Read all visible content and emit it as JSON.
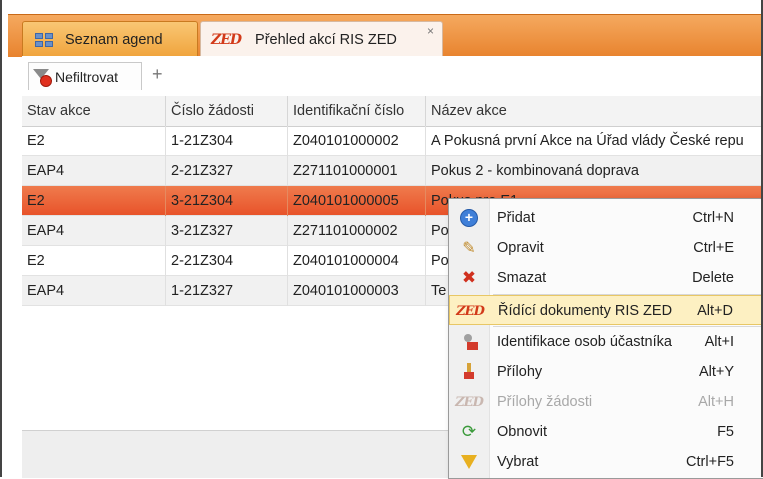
{
  "tabs": [
    {
      "label": "Seznam agend",
      "icon": "grid-icon"
    },
    {
      "label": "Přehled akcí RIS ZED",
      "icon": "zed-logo-icon",
      "close": "×"
    }
  ],
  "zed_logo_text": "ZED",
  "toolbar": {
    "filter_label": "Nefiltrovat",
    "add_tab": "+"
  },
  "grid": {
    "columns": [
      "Stav akce",
      "Číslo žádosti",
      "Identifikační číslo",
      "Název akce"
    ],
    "rows": [
      {
        "c": [
          "E2",
          "1-21Z304",
          "Z040101000002",
          "A Pokusná první Akce na Úřad vlády České repu"
        ]
      },
      {
        "c": [
          "EAP4",
          "2-21Z327",
          "Z271101000001",
          "Pokus 2 - kombinovaná doprava"
        ]
      },
      {
        "c": [
          "E2",
          "3-21Z304",
          "Z040101000005",
          "Pokus pro E1"
        ]
      },
      {
        "c": [
          "EAP4",
          "3-21Z327",
          "Z271101000002",
          "Po"
        ]
      },
      {
        "c": [
          "E2",
          "2-21Z304",
          "Z040101000004",
          "Po"
        ]
      },
      {
        "c": [
          "EAP4",
          "1-21Z327",
          "Z040101000003",
          "Te"
        ]
      }
    ],
    "selected_row": 2
  },
  "context_menu": [
    {
      "label": "Přidat",
      "shortcut": "Ctrl+N",
      "icon": "add-icon"
    },
    {
      "label": "Opravit",
      "shortcut": "Ctrl+E",
      "icon": "edit-icon"
    },
    {
      "label": "Smazat",
      "shortcut": "Delete",
      "icon": "delete-icon"
    },
    {
      "label": "Řídící dokumenty RIS ZED",
      "shortcut": "Alt+D",
      "icon": "zed-logo-icon",
      "highlighted": true
    },
    {
      "label": "Identifikace osob účastníka",
      "shortcut": "Alt+I",
      "icon": "person-card-icon"
    },
    {
      "label": "Přílohy",
      "shortcut": "Alt+Y",
      "icon": "attachment-icon"
    },
    {
      "label": "Přílohy žádosti",
      "shortcut": "Alt+H",
      "icon": "zed-logo-icon",
      "disabled": true
    },
    {
      "label": "Obnovit",
      "shortcut": "F5",
      "icon": "refresh-icon"
    },
    {
      "label": "Vybrat",
      "shortcut": "Ctrl+F5",
      "icon": "funnel-icon"
    }
  ],
  "colors": {
    "tab_bar": "#e8832e",
    "selected_row": "#e8532a",
    "menu_highlight": "#fdf0c2"
  }
}
